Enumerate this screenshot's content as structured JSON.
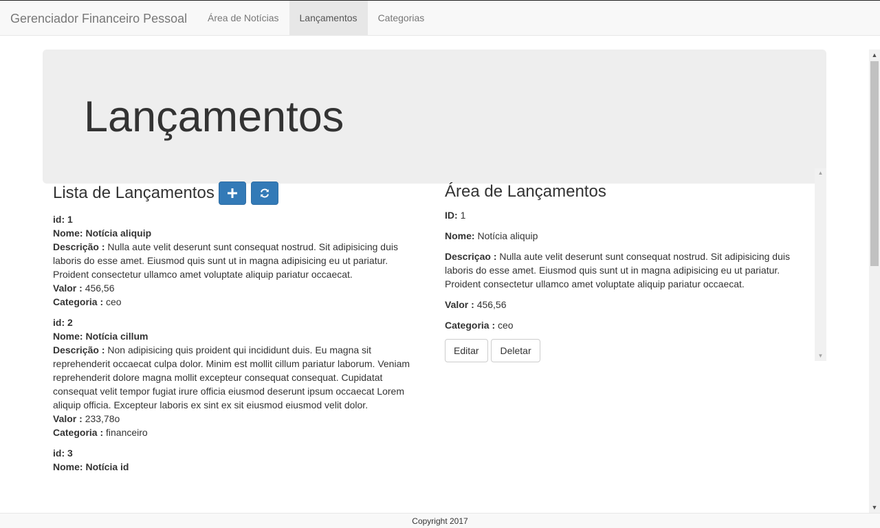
{
  "navbar": {
    "brand": "Gerenciador Financeiro Pessoal",
    "items": [
      {
        "label": "Área de Notícias",
        "active": false
      },
      {
        "label": "Lançamentos",
        "active": true
      },
      {
        "label": "Categorias",
        "active": false
      }
    ]
  },
  "jumbotron": {
    "title": "Lançamentos"
  },
  "list": {
    "title": "Lista de Lançamentos",
    "add_icon": "plus-icon",
    "refresh_icon": "refresh-icon",
    "labels": {
      "id": "id:",
      "nome": "Nome:",
      "descricao": "Descrição :",
      "valor": "Valor :",
      "categoria": "Categoria :"
    },
    "entries": [
      {
        "id": "1",
        "nome": "Notícia aliquip",
        "descricao": "Nulla aute velit deserunt sunt consequat nostrud. Sit adipisicing duis laboris do esse amet. Eiusmod quis sunt ut in magna adipisicing eu ut pariatur. Proident consectetur ullamco amet voluptate aliquip pariatur occaecat.",
        "valor": "456,56",
        "categoria": "ceo"
      },
      {
        "id": "2",
        "nome": "Notícia cillum",
        "descricao": "Non adipisicing quis proident qui incididunt duis. Eu magna sit reprehenderit occaecat culpa dolor. Minim est mollit cillum pariatur laborum. Veniam reprehenderit dolore magna mollit excepteur consequat consequat. Cupidatat consequat velit tempor fugiat irure officia eiusmod deserunt ipsum occaecat Lorem aliquip officia. Excepteur laboris ex sint ex sit eiusmod eiusmod velit dolor.",
        "valor": "233,78o",
        "categoria": "financeiro"
      },
      {
        "id": "3",
        "nome": "Notícia id"
      }
    ]
  },
  "detail": {
    "title": "Área de Lançamentos",
    "labels": {
      "id": "ID:",
      "nome": "Nome:",
      "descricao": "Descriçao :",
      "valor": "Valor :",
      "categoria": "Categoria :"
    },
    "id": "1",
    "nome": "Notícia aliquip",
    "descricao": "Nulla aute velit deserunt sunt consequat nostrud. Sit adipisicing duis laboris do esse amet. Eiusmod quis sunt ut in magna adipisicing eu ut pariatur. Proident consectetur ullamco amet voluptate aliquip pariatur occaecat.",
    "valor": "456,56",
    "categoria": "ceo",
    "edit_label": "Editar",
    "delete_label": "Deletar"
  },
  "footer": {
    "text": "Copyright 2017"
  },
  "colors": {
    "primary": "#337ab7",
    "navbar_bg": "#f8f8f8",
    "jumbotron_bg": "#eeeeee"
  }
}
